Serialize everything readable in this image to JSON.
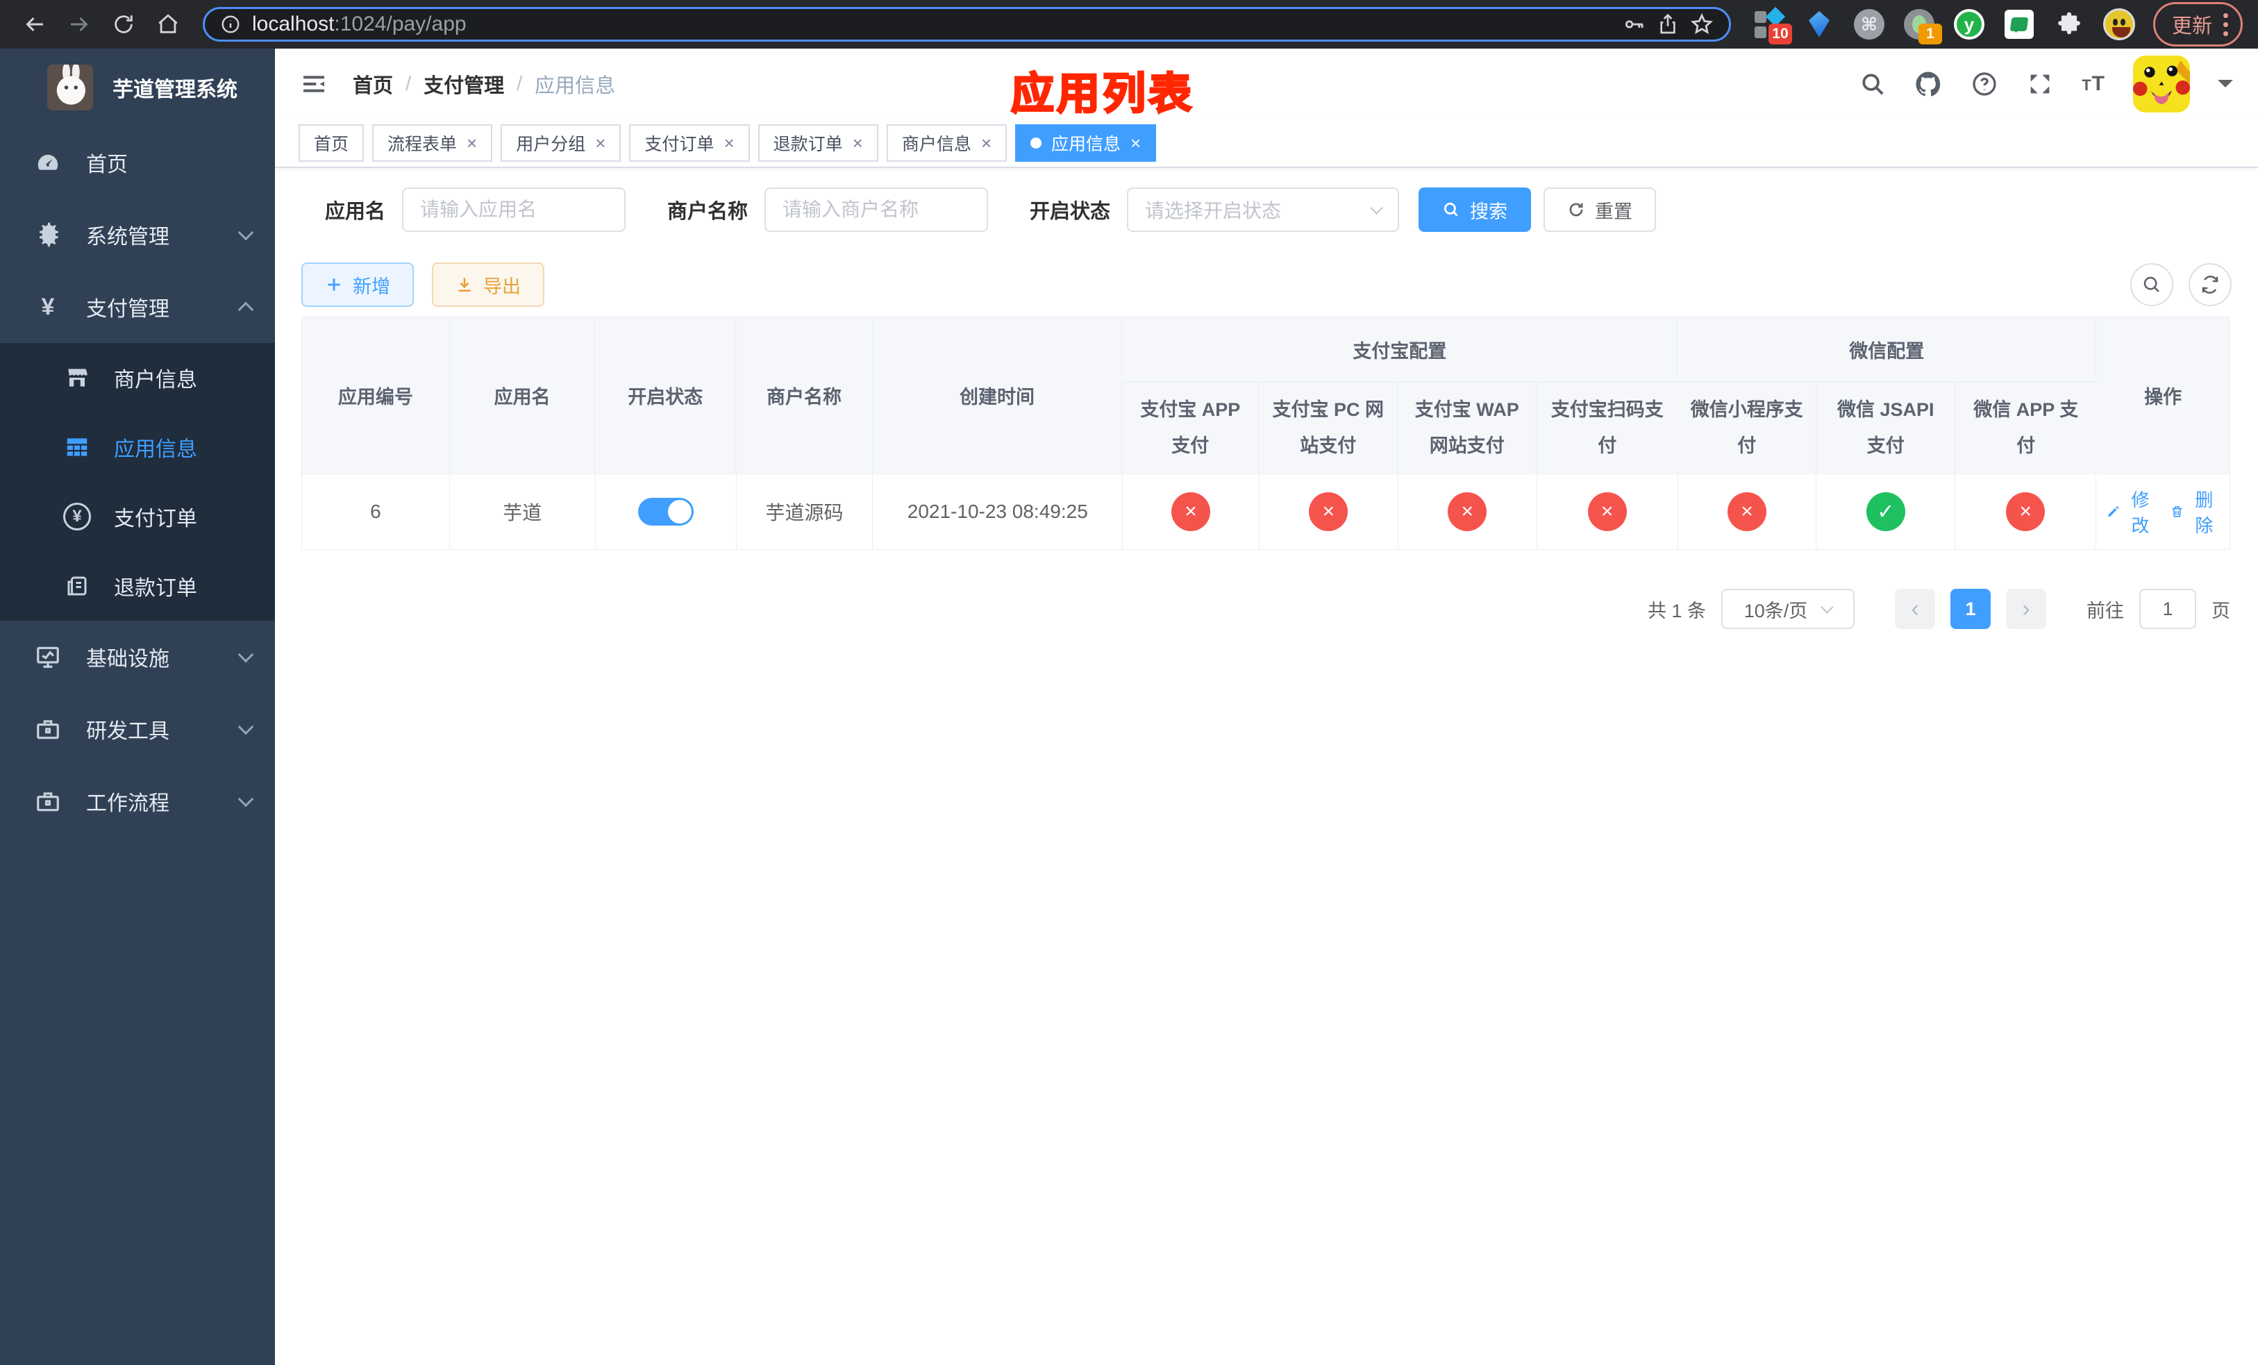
{
  "browser": {
    "url_host": "localhost",
    "url_path": ":1024/pay/app",
    "ext_badge_10": "10",
    "ext_badge_1": "1",
    "ext_y_label": "y",
    "cmd_glyph": "⌘",
    "update_label": "更新"
  },
  "sidebar": {
    "logo_title": "芋道管理系统",
    "items": {
      "home": "首页",
      "system": "系统管理",
      "payment": "支付管理",
      "merchant": "商户信息",
      "app_info": "应用信息",
      "pay_order": "支付订单",
      "refund_order": "退款订单",
      "infra": "基础设施",
      "dev_tools": "研发工具",
      "workflow": "工作流程"
    },
    "yen_glyph": "¥"
  },
  "navbar": {
    "breadcrumb": {
      "home": "首页",
      "sep": "/",
      "section": "支付管理",
      "current": "应用信息"
    }
  },
  "annotation": {
    "text": "应用列表",
    "color": "#ff2600"
  },
  "tabs": [
    {
      "label": "首页"
    },
    {
      "label": "流程表单"
    },
    {
      "label": "用户分组"
    },
    {
      "label": "支付订单"
    },
    {
      "label": "退款订单"
    },
    {
      "label": "商户信息"
    },
    {
      "label": "应用信息"
    }
  ],
  "ui": {
    "close_glyph": "×",
    "prev_glyph": "‹",
    "next_glyph": "›",
    "question_glyph": "?"
  },
  "filters": {
    "app_name_label": "应用名",
    "app_name_placeholder": "请输入应用名",
    "merchant_label": "商户名称",
    "merchant_placeholder": "请输入商户名称",
    "status_label": "开启状态",
    "status_placeholder": "请选择开启状态",
    "search_label": "搜索",
    "reset_label": "重置"
  },
  "toolbar": {
    "add_label": "新增",
    "export_label": "导出"
  },
  "table": {
    "headers": {
      "app_id": "应用编号",
      "app_name": "应用名",
      "status": "开启状态",
      "merchant": "商户名称",
      "created": "创建时间",
      "alipay_group": "支付宝配置",
      "alipay_cols": [
        "支付宝 APP 支付",
        "支付宝 PC 网站支付",
        "支付宝 WAP 网站支付",
        "支付宝扫码支付"
      ],
      "wechat_group": "微信配置",
      "wechat_cols": [
        "微信小程序支付",
        "微信 JSAPI 支付",
        "微信 APP 支付"
      ],
      "ops": "操作"
    },
    "row": {
      "app_id": "6",
      "app_name": "芋道",
      "enabled": true,
      "merchant": "芋道源码",
      "created": "2021-10-23 08:49:25",
      "configs": [
        false,
        false,
        false,
        false,
        false,
        true,
        false
      ],
      "ok_glyph": "✓",
      "fail_glyph": "×",
      "edit_label": "修改",
      "delete_label": "删除"
    }
  },
  "pagination": {
    "total": "共 1 条",
    "page_size": "10条/页",
    "page": "1",
    "goto_label": "前往",
    "goto_value": "1",
    "unit_label": "页"
  },
  "colors": {
    "primary": "#409eff",
    "success": "#1ec05f",
    "danger": "#f5544d",
    "warning": "#e6a23c",
    "sidebar_bg": "#304156",
    "submenu_bg": "#1f2d3d",
    "annotation_red": "#ff2600"
  }
}
